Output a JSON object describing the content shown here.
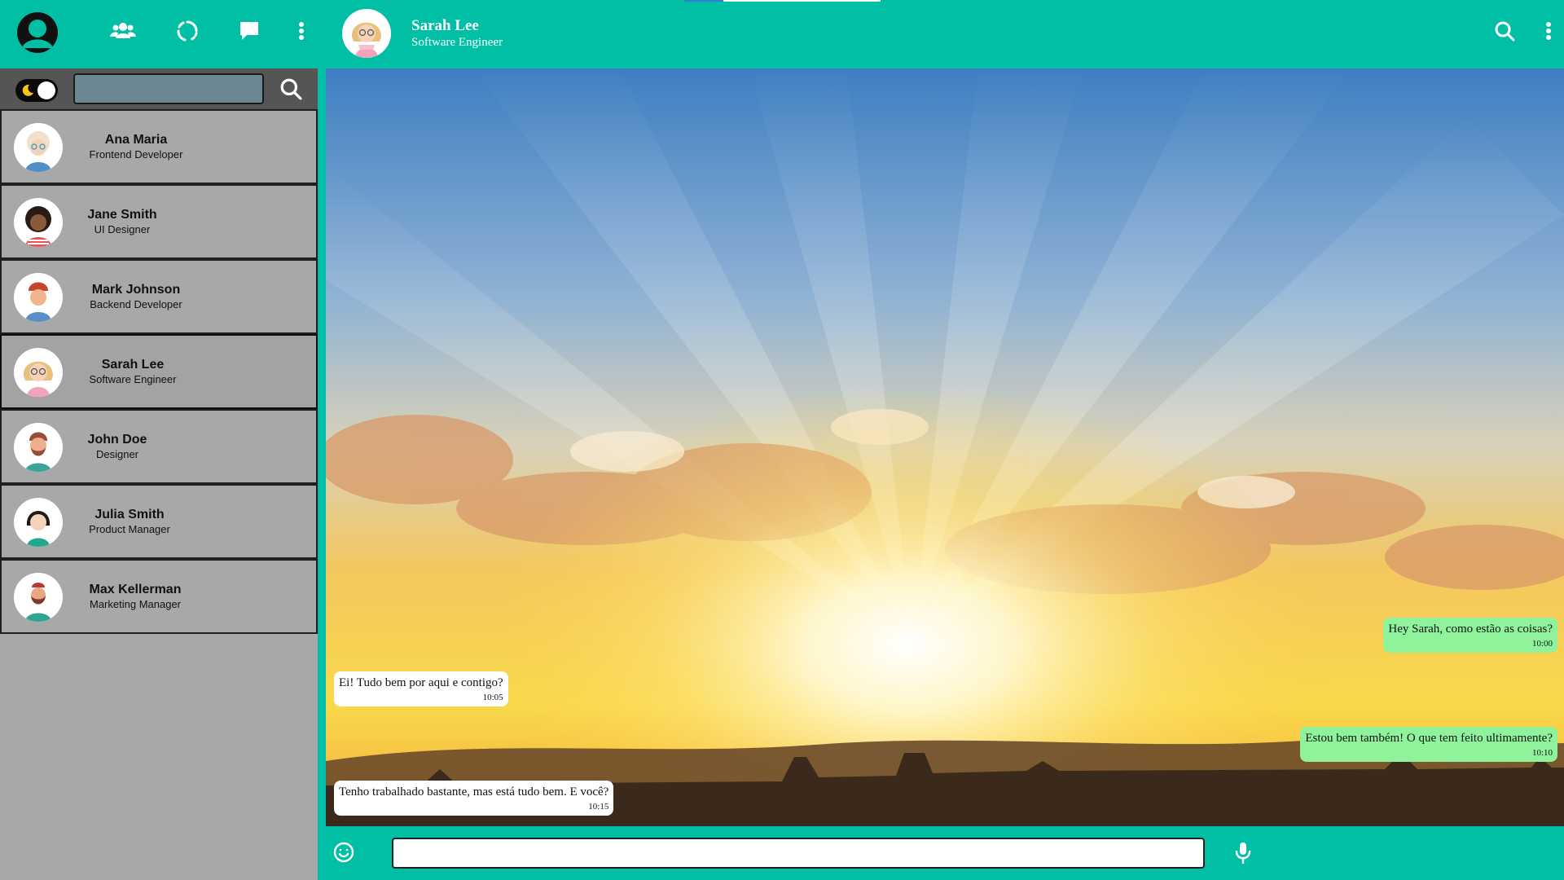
{
  "window": {
    "width": 1920,
    "height": 1080
  },
  "colors": {
    "accent": "#00bfa5",
    "sidebar_bg": "#a8a8a8",
    "sidebar_tools_bg": "#555555",
    "incoming_bubble": "#ffffff",
    "outgoing_bubble": "#8ef39b",
    "progress": "#2f7fd6"
  },
  "topbar": {
    "icons": [
      "user-avatar-icon",
      "community-icon",
      "status-icon",
      "new-chat-icon",
      "more-vertical-icon"
    ]
  },
  "chat_header": {
    "name": "Sarah Lee",
    "role": "Software Engineer",
    "icons": [
      "search-icon",
      "more-vertical-icon"
    ]
  },
  "sidebar": {
    "dark_mode_toggle": "moon-icon",
    "search": {
      "value": "",
      "placeholder": ""
    },
    "contacts": [
      {
        "name": "Ana Maria",
        "role": "Frontend Developer",
        "avatar": "woman-glasses-avatar",
        "active": false
      },
      {
        "name": "Jane Smith",
        "role": "UI Designer",
        "avatar": "woman-curly-hair-avatar",
        "active": false
      },
      {
        "name": "Mark Johnson",
        "role": "Backend Developer",
        "avatar": "man-red-hair-avatar",
        "active": false
      },
      {
        "name": "Sarah Lee",
        "role": "Software Engineer",
        "avatar": "woman-blonde-glasses-avatar",
        "active": true
      },
      {
        "name": "John Doe",
        "role": "Designer",
        "avatar": "man-beard-avatar",
        "active": false
      },
      {
        "name": "Julia Smith",
        "role": "Product Manager",
        "avatar": "woman-dark-hair-avatar",
        "active": false
      },
      {
        "name": "Max Kellerman",
        "role": "Marketing Manager",
        "avatar": "man-beard-cap-avatar",
        "active": false
      }
    ]
  },
  "messages": [
    {
      "direction": "out",
      "text": "Hey Sarah, como estão as coisas?",
      "time": "10:00"
    },
    {
      "direction": "in",
      "text": "Ei! Tudo bem por aqui e contigo?",
      "time": "10:05"
    },
    {
      "direction": "out",
      "text": "Estou bem também! O que tem feito ultimamente?",
      "time": "10:10"
    },
    {
      "direction": "in",
      "text": "Tenho trabalhado bastante, mas está tudo bem. E você?",
      "time": "10:15"
    }
  ],
  "composer": {
    "value": "",
    "placeholder": "",
    "icons": [
      "emoji-icon",
      "microphone-icon"
    ]
  }
}
